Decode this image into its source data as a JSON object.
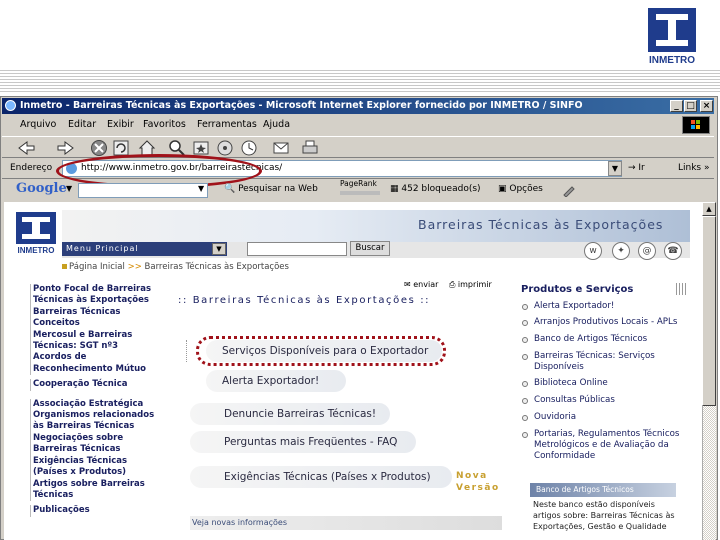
{
  "slide": {
    "logo_text": "INMETRO"
  },
  "window": {
    "title": "Inmetro - Barreiras Técnicas às Exportações - Microsoft Internet Explorer fornecido por INMETRO / SINFO",
    "controls": [
      "_",
      "□",
      "×"
    ]
  },
  "menubar": [
    "Arquivo",
    "Editar",
    "Exibir",
    "Favoritos",
    "Ferramentas",
    "Ajuda"
  ],
  "address": {
    "label": "Endereço",
    "url": "http://www.inmetro.gov.br/barreirastecnicas/",
    "go": "Ir",
    "links": "Links »"
  },
  "googlebar": {
    "brand": "Google",
    "search_web": "Pesquisar na Web",
    "pagerank": "PageRank",
    "blocked": "452 bloqueado(s)",
    "options": "Opções"
  },
  "site": {
    "logo_text": "INMETRO",
    "title": "Barreiras Técnicas às Exportações",
    "menu_label": "Menu Principal",
    "search_button": "Buscar",
    "breadcrumb_home": "Página Inicial",
    "breadcrumb_sep": ">>",
    "breadcrumb_current": "Barreiras Técnicas às Exportações"
  },
  "left_nav": [
    "Ponto Focal de Barreiras",
    "Técnicas às Exportações",
    "Barreiras Técnicas",
    "Conceitos",
    "Mercosul e Barreiras",
    "Técnicas: SGT nº3",
    "Acordos de",
    "Reconhecimento Mútuo",
    "Cooperação Técnica",
    "Associação Estratégica",
    "Organismos relacionados",
    "às Barreiras Técnicas",
    "Negociações sobre",
    "Barreiras Técnicas",
    "Exigências Técnicas",
    "(Países x Produtos)",
    "Artigos sobre Barreiras",
    "Técnicas",
    "Publicações"
  ],
  "center": {
    "send": "enviar",
    "print": "imprimir",
    "title": ":: Barreiras Técnicas às Exportações ::",
    "items": [
      "Serviços Disponíveis para o Exportador",
      "Alerta Exportador!",
      "Denuncie Barreiras Técnicas!",
      "Perguntas mais Freqüentes - FAQ",
      "Exigências Técnicas (Países x Produtos)"
    ],
    "new_line1": "Nova",
    "new_line2": "Versão",
    "footer": "Veja novas informações"
  },
  "right": {
    "title": "Produtos e Serviços",
    "items": [
      "Alerta Exportador!",
      "Arranjos Produtivos Locais - APLs",
      "Banco de Artigos Técnicos",
      "Barreiras Técnicas: Serviços Disponíveis",
      "Biblioteca Online",
      "Consultas Públicas",
      "Ouvidoria",
      "Portarias, Regulamentos Técnicos Metrológicos e de Avaliação da Conformidade"
    ],
    "banco_header": "Banco de Artigos Técnicos",
    "banco_text": "Neste banco estão disponíveis artigos sobre: Barreiras Técnicas às Exportações, Gestão e Qualidade"
  }
}
